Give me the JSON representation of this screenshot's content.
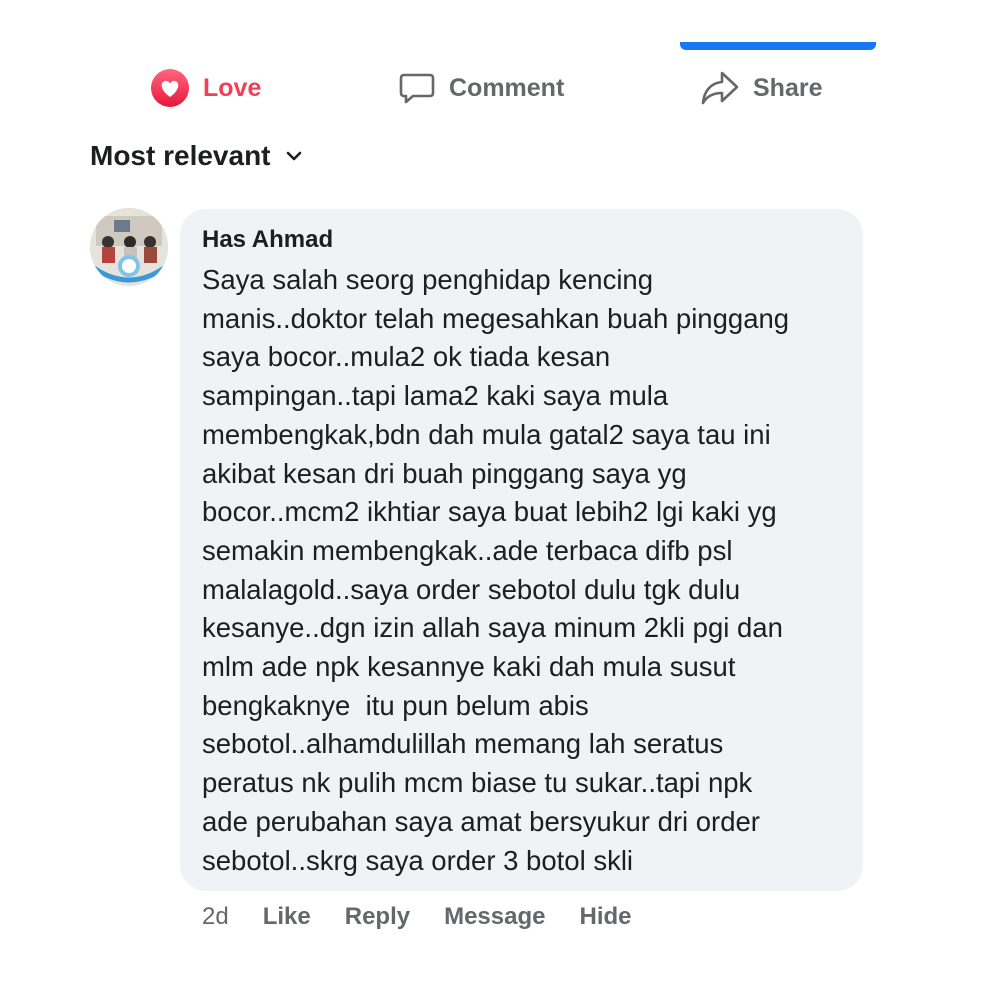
{
  "actions": {
    "love_label": "Love",
    "comment_label": "Comment",
    "share_label": "Share",
    "love_color": "#f33e58",
    "icons": [
      "heart-icon",
      "comment-bubble-icon",
      "share-arrow-icon"
    ]
  },
  "sort": {
    "label": "Most relevant",
    "icon": "chevron-down-icon"
  },
  "comment": {
    "author": "Has Ahmad",
    "lines": [
      "Saya salah seorg penghidap kencing",
      "manis..doktor telah megesahkan buah pinggang",
      "saya bocor..mula2 ok tiada kesan",
      "sampingan..tapi lama2 kaki saya mula",
      "membengkak,bdn dah mula gatal2 saya tau ini",
      "akibat kesan dri buah pinggang saya yg",
      "bocor..mcm2 ikhtiar saya buat lebih2 lgi kaki yg",
      "semakin membengkak..ade terbaca difb psl",
      "malalagold..saya order sebotol dulu tgk dulu",
      "kesanye..dgn izin allah saya minum 2kli pgi dan",
      "mlm ade npk kesannye kaki dah mula susut",
      "bengkaknye  itu pun belum abis",
      "sebotol..alhamdulillah memang lah seratus",
      "peratus nk pulih mcm biase tu sukar..tapi npk",
      "ade perubahan saya amat bersyukur dri order",
      "sebotol..skrg saya order 3 botol skli"
    ],
    "time": "2d",
    "like_label": "Like",
    "reply_label": "Reply",
    "message_label": "Message",
    "hide_label": "Hide"
  },
  "colors": {
    "accent_blue": "#1877f2",
    "bubble_bg": "#f0f2f5",
    "secondary_text": "#65676b"
  }
}
